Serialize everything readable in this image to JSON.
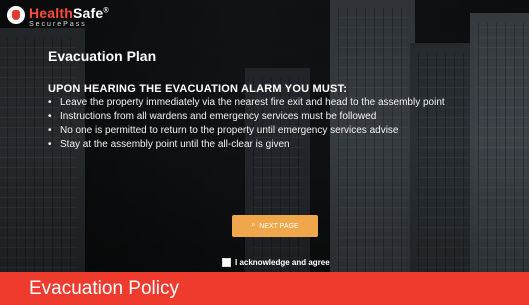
{
  "brand": {
    "name_prefix": "Health",
    "name_suffix": "Safe",
    "trademark": "®",
    "subtitle": "SecurePass"
  },
  "content": {
    "title": "Evacuation Plan",
    "heading": "UPON HEARING THE EVACUATION ALARM YOU MUST:",
    "items": [
      "Leave the property immediately via the nearest fire exit and head to the assembly point",
      "Instructions from all wardens and emergency services must be followed",
      "No one is permitted to return to the property until emergency services advise",
      "Stay at the assembly point until the all-clear is given"
    ]
  },
  "actions": {
    "next_label": "NEXT PAGE",
    "acknowledge_label": "I acknowledge and agree"
  },
  "footer": {
    "title": "Evacuation Policy"
  },
  "colors": {
    "accent": "#ef3b2d",
    "button": "#f0a64a"
  },
  "icons": {
    "brand": "healthsafe-logo-icon",
    "button": "search-icon",
    "checkbox": "checkbox-icon"
  }
}
